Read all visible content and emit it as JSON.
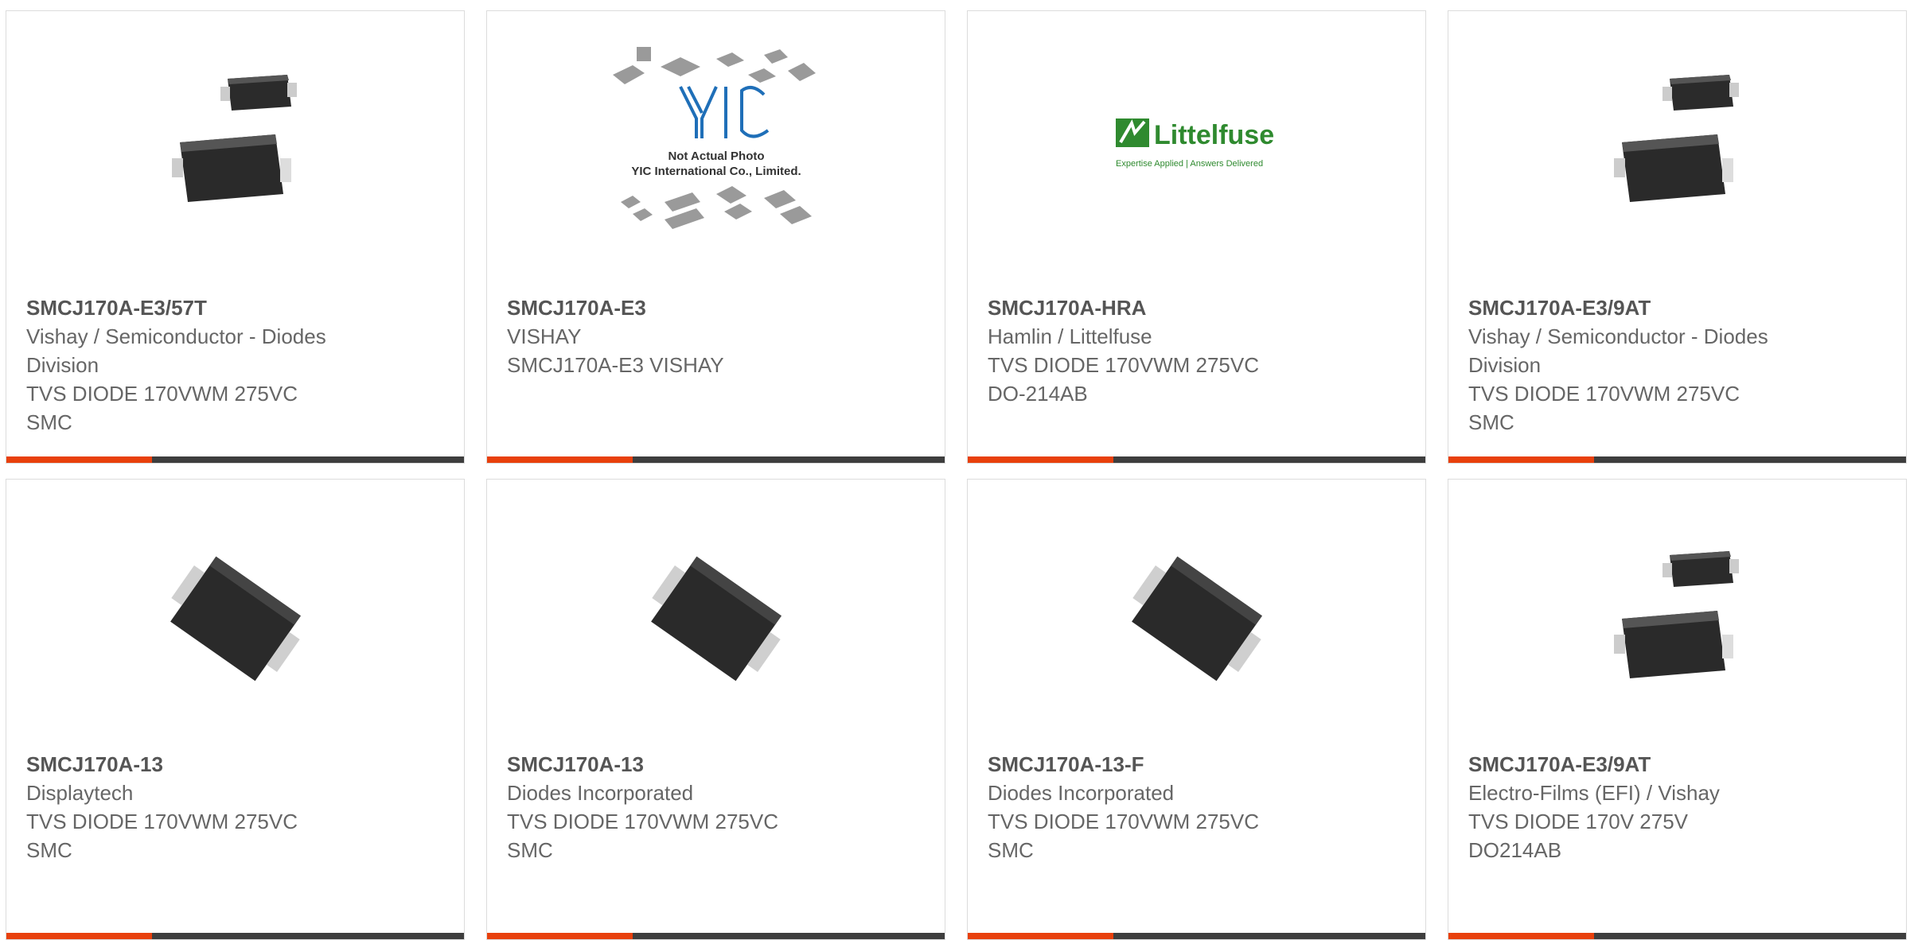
{
  "products": [
    {
      "part": "SMCJ170A-E3/57T",
      "lines": [
        "Vishay / Semiconductor - Diodes",
        "Division",
        "TVS DIODE 170VWM 275VC",
        "SMC"
      ],
      "image": "smc-diode-pair-photo"
    },
    {
      "part": "SMCJ170A-E3",
      "lines": [
        "VISHAY",
        "SMCJ170A-E3 VISHAY"
      ],
      "image": "yic-not-actual-photo",
      "image_text": {
        "logo": "YIC",
        "l1": "Not Actual Photo",
        "l2": "YIC International Co., Limited."
      }
    },
    {
      "part": "SMCJ170A-HRA",
      "lines": [
        "Hamlin / Littelfuse",
        "TVS DIODE 170VWM 275VC",
        "DO-214AB"
      ],
      "image": "littelfuse-logo",
      "image_text": {
        "brand": "Littelfuse",
        "tagline": "Expertise Applied | Answers Delivered"
      }
    },
    {
      "part": "SMCJ170A-E3/9AT",
      "lines": [
        "Vishay / Semiconductor - Diodes",
        "Division",
        "TVS DIODE 170VWM 275VC",
        "SMC"
      ],
      "image": "smc-diode-pair-photo"
    },
    {
      "part": "SMCJ170A-13",
      "lines": [
        "Displaytech",
        "TVS DIODE 170VWM 275VC",
        "SMC"
      ],
      "image": "smc-diode-single-photo"
    },
    {
      "part": "SMCJ170A-13",
      "lines": [
        "Diodes Incorporated",
        "TVS DIODE 170VWM 275VC",
        "SMC"
      ],
      "image": "smc-diode-single-photo"
    },
    {
      "part": "SMCJ170A-13-F",
      "lines": [
        "Diodes Incorporated",
        "TVS DIODE 170VWM 275VC",
        "SMC"
      ],
      "image": "smc-diode-single-photo"
    },
    {
      "part": "SMCJ170A-E3/9AT",
      "lines": [
        "Electro-Films (EFI) / Vishay",
        "TVS DIODE 170V 275V",
        "DO214AB"
      ],
      "image": "smc-diode-pair-photo"
    }
  ],
  "colors": {
    "accent": "#e8400c",
    "bar": "#3e3e3e",
    "text": "#666666",
    "border": "#dcdcdc"
  }
}
